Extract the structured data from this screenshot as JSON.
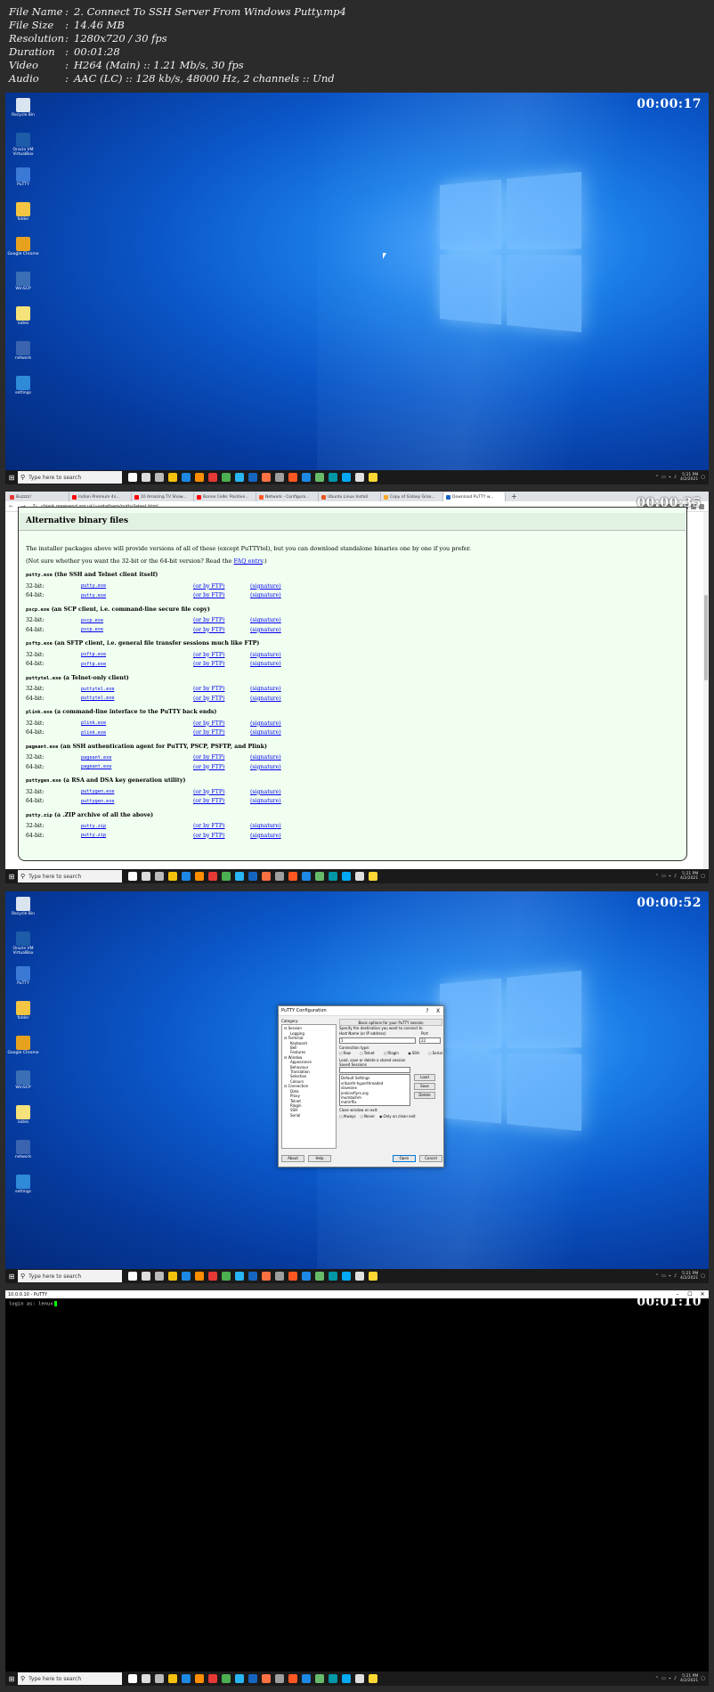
{
  "info": [
    {
      "key": "File Name",
      "value": "2. Connect To SSH Server From Windows Putty.mp4"
    },
    {
      "key": "File Size",
      "value": "14.46 MB"
    },
    {
      "key": "Resolution",
      "value": "1280x720 / 30 fps"
    },
    {
      "key": "Duration",
      "value": "00:01:28"
    },
    {
      "key": "Video",
      "value": "H264 (Main) :: 1.21 Mb/s, 30 fps"
    },
    {
      "key": "Audio",
      "value": "AAC (LC) :: 128 kb/s, 48000 Hz, 2 channels :: Und"
    }
  ],
  "frames": {
    "f1": {
      "timestamp": "00:00:17"
    },
    "f2": {
      "timestamp": "00:00:35"
    },
    "f3": {
      "timestamp": "00:00:52"
    },
    "f4": {
      "timestamp": "00:01:10"
    }
  },
  "taskbar": {
    "search_placeholder": "Type here to search",
    "app_colors": [
      "#ffffff",
      "#dddddd",
      "#bbbbbb",
      "#f4c20d",
      "#1e88e5",
      "#ff8f00",
      "#e53935",
      "#4caf50",
      "#29b6f6",
      "#1565c0",
      "#ff7043",
      "#9e9e9e",
      "#ff5722",
      "#1e88e5",
      "#66bb6a",
      "#0097a7",
      "#03a9f4",
      "#e0e0e0",
      "#fdd835"
    ],
    "clock_time": "5:21 PM",
    "clock_date": "4/2/2021"
  },
  "desktop_icons": [
    {
      "label": "Recycle Bin",
      "color": "#d9e4f0"
    },
    {
      "label": "Oracle VM VirtualBox",
      "color": "#1c5ca8"
    },
    {
      "label": "PuTTY",
      "color": "#3a7ad6"
    },
    {
      "label": "folder",
      "color": "#f4c542"
    },
    {
      "label": "Google Chrome",
      "color": "#e6a21f"
    },
    {
      "label": "WinSCP",
      "color": "#3b6fb5"
    },
    {
      "label": "notes",
      "color": "#f5e27a"
    },
    {
      "label": "network",
      "color": "#3a64b0"
    },
    {
      "label": "settings",
      "color": "#2f8ad8"
    }
  ],
  "browser": {
    "tabs": [
      {
        "label": "Buzzzz!",
        "color": "#e53935"
      },
      {
        "label": "Indian Premium 4n...",
        "color": "#ff0000"
      },
      {
        "label": "10 Amazing TV Show...",
        "color": "#ff0000"
      },
      {
        "label": "Bonne Celle: Positive...",
        "color": "#ff0000"
      },
      {
        "label": "Network - Configura...",
        "color": "#ff5722"
      },
      {
        "label": "Ubuntu Linux Install",
        "color": "#e95420"
      },
      {
        "label": "Copy of Galaxy Groo...",
        "color": "#f9a825"
      },
      {
        "label": "Download PuTTY w...",
        "color": "#1565c0"
      }
    ],
    "url": "chiark.greenend.org.uk/~sgtatham/putty/latest.html",
    "heading": "Alternative binary files",
    "intro1": "The installer packages above will provide versions of all of these (except PuTTYtel), but you can download standalone binaries one by one if you prefer.",
    "intro2_prefix": "(Not sure whether you want the 32-bit or the 64-bit version? Read the ",
    "intro2_link": "FAQ entry",
    "intro2_suffix": ".)",
    "ftp_label": "(or by FTP)",
    "sig_label": "(signature)",
    "sections": [
      {
        "code": "putty.exe",
        "desc": " (the SSH and Telnet client itself)",
        "rows": [
          {
            "bit": "32-bit:",
            "file": "putty.exe"
          },
          {
            "bit": "64-bit:",
            "file": "putty.exe"
          }
        ]
      },
      {
        "code": "pscp.exe",
        "desc": " (an SCP client, i.e. command-line secure file copy)",
        "rows": [
          {
            "bit": "32-bit:",
            "file": "pscp.exe"
          },
          {
            "bit": "64-bit:",
            "file": "pscp.exe"
          }
        ]
      },
      {
        "code": "psftp.exe",
        "desc": " (an SFTP client, i.e. general file transfer sessions much like FTP)",
        "rows": [
          {
            "bit": "32-bit:",
            "file": "psftp.exe"
          },
          {
            "bit": "64-bit:",
            "file": "psftp.exe"
          }
        ]
      },
      {
        "code": "puttytel.exe",
        "desc": " (a Telnet-only client)",
        "rows": [
          {
            "bit": "32-bit:",
            "file": "puttytel.exe"
          },
          {
            "bit": "64-bit:",
            "file": "puttytel.exe"
          }
        ]
      },
      {
        "code": "plink.exe",
        "desc": " (a command-line interface to the PuTTY back ends)",
        "rows": [
          {
            "bit": "32-bit:",
            "file": "plink.exe"
          },
          {
            "bit": "64-bit:",
            "file": "plink.exe"
          }
        ]
      },
      {
        "code": "pageant.exe",
        "desc": " (an SSH authentication agent for PuTTY, PSCP, PSFTP, and Plink)",
        "rows": [
          {
            "bit": "32-bit:",
            "file": "pageant.exe"
          },
          {
            "bit": "64-bit:",
            "file": "pageant.exe"
          }
        ]
      },
      {
        "code": "puttygen.exe",
        "desc": " (a RSA and DSA key generation utility)",
        "rows": [
          {
            "bit": "32-bit:",
            "file": "puttygen.exe"
          },
          {
            "bit": "64-bit:",
            "file": "puttygen.exe"
          }
        ]
      },
      {
        "code": "putty.zip",
        "desc": " (a .ZIP archive of all the above)",
        "rows": [
          {
            "bit": "32-bit:",
            "file": "putty.zip"
          },
          {
            "bit": "64-bit:",
            "file": "putty.zip"
          }
        ]
      }
    ]
  },
  "putty_dialog": {
    "title": "PuTTY Configuration",
    "help_glyph": "?",
    "close_glyph": "X",
    "category_label": "Category:",
    "tree": [
      {
        "label": "Session",
        "level": 1
      },
      {
        "label": "Logging",
        "level": 2
      },
      {
        "label": "Terminal",
        "level": 1
      },
      {
        "label": "Keyboard",
        "level": 2
      },
      {
        "label": "Bell",
        "level": 2
      },
      {
        "label": "Features",
        "level": 2
      },
      {
        "label": "Window",
        "level": 1
      },
      {
        "label": "Appearance",
        "level": 2
      },
      {
        "label": "Behaviour",
        "level": 2
      },
      {
        "label": "Translation",
        "level": 2
      },
      {
        "label": "Selection",
        "level": 2
      },
      {
        "label": "Colours",
        "level": 2
      },
      {
        "label": "Connection",
        "level": 1
      },
      {
        "label": "Data",
        "level": 2
      },
      {
        "label": "Proxy",
        "level": 2
      },
      {
        "label": "Telnet",
        "level": 2
      },
      {
        "label": "Rlogin",
        "level": 2
      },
      {
        "label": "SSH",
        "level": 2
      },
      {
        "label": "Serial",
        "level": 2
      }
    ],
    "banner": "Basic options for your PuTTY session",
    "dest_label": "Specify the destination you want to connect to",
    "host_label": "Host Name (or IP address)",
    "port_label": "Port",
    "host_value": "1",
    "port_value": "22",
    "conn_type_label": "Connection type:",
    "conn_types": [
      {
        "label": "Raw",
        "selected": false
      },
      {
        "label": "Telnet",
        "selected": false
      },
      {
        "label": "Rlogin",
        "selected": false
      },
      {
        "label": "SSH",
        "selected": true
      },
      {
        "label": "Serial",
        "selected": false
      }
    ],
    "sessions_label": "Load, save or delete a stored session",
    "saved_label": "Saved Sessions",
    "sessions": [
      "Default Settings",
      "srikanth-hyperthreaded",
      "slaveone",
      "jenkinsfiyrs.org",
      "mumbaihm",
      "mahirflix"
    ],
    "load": "Load",
    "save": "Save",
    "delete": "Delete",
    "close_exit_label": "Close window on exit:",
    "exit_opts": [
      {
        "label": "Always",
        "selected": false
      },
      {
        "label": "Never",
        "selected": false
      },
      {
        "label": "Only on clean exit",
        "selected": true
      }
    ],
    "about": "About",
    "help": "Help",
    "open": "Open",
    "cancel": "Cancel"
  },
  "terminal": {
    "title": "10.0.0.10 - PuTTY",
    "prompt": "login as: lenux"
  }
}
